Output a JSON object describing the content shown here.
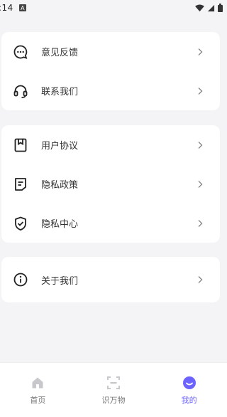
{
  "status": {
    "time": ":14",
    "badge": "A"
  },
  "groups": [
    [
      {
        "label": "意见反馈",
        "icon": "chat-bubble-icon"
      },
      {
        "label": "联系我们",
        "icon": "headset-icon"
      }
    ],
    [
      {
        "label": "用户协议",
        "icon": "bookmark-icon"
      },
      {
        "label": "隐私政策",
        "icon": "document-icon"
      },
      {
        "label": "隐私中心",
        "icon": "shield-check-icon"
      }
    ],
    [
      {
        "label": "关于我们",
        "icon": "info-icon"
      }
    ]
  ],
  "tabs": [
    {
      "label": "首页",
      "icon": "home-icon",
      "active": false
    },
    {
      "label": "识万物",
      "icon": "scan-icon",
      "active": false
    },
    {
      "label": "我的",
      "icon": "smiley-icon",
      "active": true
    }
  ],
  "colors": {
    "accent": "#6c63ff",
    "background": "#f4f4f6"
  }
}
